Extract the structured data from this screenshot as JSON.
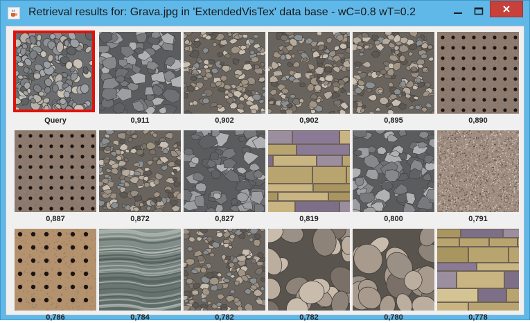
{
  "window": {
    "title": "Retrieval results for: Grava.jpg in 'ExtendedVisTex' data base - wC=0.8 wT=0.2",
    "app_icon": "java-cup-icon",
    "controls": [
      "minimize-icon",
      "maximize-icon",
      "close-icon"
    ]
  },
  "colors": {
    "titlebar": "#5fb8e8",
    "close_button": "#c7403a",
    "query_highlight": "#e0120c",
    "client_background": "#f0f0f0"
  },
  "results": [
    {
      "label": "Query",
      "texture": "pebbles-round",
      "is_query": true
    },
    {
      "label": "0,911",
      "texture": "gravel-angular"
    },
    {
      "label": "0,902",
      "texture": "gravel-mixed"
    },
    {
      "label": "0,902",
      "texture": "gravel-mixed"
    },
    {
      "label": "0,895",
      "texture": "gravel-mixed"
    },
    {
      "label": "0,890",
      "texture": "perforated-board"
    },
    {
      "label": "0,887",
      "texture": "perforated-board"
    },
    {
      "label": "0,872",
      "texture": "gravel-mixed"
    },
    {
      "label": "0,827",
      "texture": "gravel-angular"
    },
    {
      "label": "0,819",
      "texture": "stone-tiles"
    },
    {
      "label": "0,800",
      "texture": "gravel-angular"
    },
    {
      "label": "0,791",
      "texture": "granite-speckle"
    },
    {
      "label": "0,786",
      "texture": "perforated-board-tan"
    },
    {
      "label": "0,784",
      "texture": "water-surface"
    },
    {
      "label": "0,782",
      "texture": "gravel-mixed"
    },
    {
      "label": "0,782",
      "texture": "river-stones"
    },
    {
      "label": "0,780",
      "texture": "river-stones"
    },
    {
      "label": "0,778",
      "texture": "stone-tiles"
    }
  ]
}
